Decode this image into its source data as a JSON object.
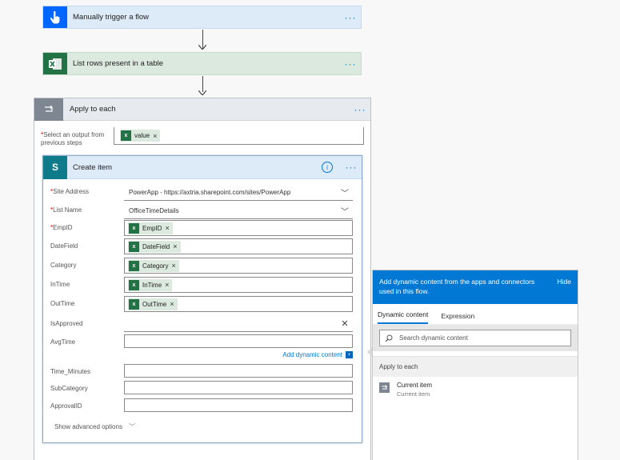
{
  "trigger": {
    "title": "Manually trigger a flow",
    "more": "···"
  },
  "excel": {
    "title": "List rows present in a table",
    "more": "···"
  },
  "apply": {
    "title": "Apply to each",
    "more": "···",
    "output_label_req": "*",
    "output_label": "Select an output from previous steps",
    "output_token": "value"
  },
  "create": {
    "title": "Create item",
    "more": "···",
    "info": "i",
    "fields": [
      {
        "label": "Site Address",
        "required": true,
        "type": "dropdown",
        "value": "PowerApp - https://axtria.sharepoint.com/sites/PowerApp"
      },
      {
        "label": "List Name",
        "required": true,
        "type": "dropdown",
        "value": "OfficeTimeDetails"
      },
      {
        "label": "EmpID",
        "required": true,
        "type": "token",
        "value": "EmpID"
      },
      {
        "label": "DateField",
        "required": false,
        "type": "token",
        "value": "DateField"
      },
      {
        "label": "Category",
        "required": false,
        "type": "token",
        "value": "Category"
      },
      {
        "label": "InTime",
        "required": false,
        "type": "token",
        "value": "InTime"
      },
      {
        "label": "OutTime",
        "required": false,
        "type": "token",
        "value": "OutTime"
      },
      {
        "label": "IsApproved",
        "required": false,
        "type": "clearable",
        "value": ""
      },
      {
        "label": "AvgTime",
        "required": false,
        "type": "text",
        "value": ""
      },
      {
        "label": "Time_Minutes",
        "required": false,
        "type": "text",
        "value": ""
      },
      {
        "label": "SubCategory",
        "required": false,
        "type": "text",
        "value": ""
      },
      {
        "label": "ApprovalID",
        "required": false,
        "type": "text",
        "value": ""
      }
    ],
    "add_dynamic": "Add dynamic content",
    "advanced": "Show advanced options"
  },
  "panel": {
    "header": "Add dynamic content from the apps and connectors used in this flow.",
    "hide": "Hide",
    "tabs": [
      "Dynamic content",
      "Expression"
    ],
    "active_tab": 0,
    "search_placeholder": "Search dynamic content",
    "section": "Apply to each",
    "items": [
      {
        "title": "Current item",
        "subtitle": "Current item"
      }
    ]
  },
  "colors": {
    "accent": "#0078d4",
    "excel": "#217346",
    "trigger": "#0066ff",
    "sharepoint": "#0e7a8a"
  }
}
